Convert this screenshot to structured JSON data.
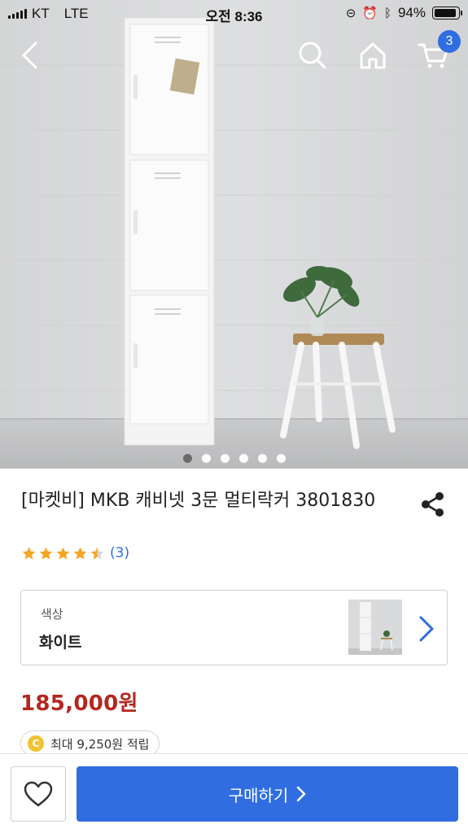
{
  "status_bar": {
    "carrier": "KT",
    "network": "LTE",
    "time": "오전 8:36",
    "battery": "94%",
    "battery_level": 0.94
  },
  "header": {
    "back_icon": "chevron-left-icon",
    "search_icon": "search-icon",
    "home_icon": "home-icon",
    "cart_icon": "cart-icon",
    "cart_count": "3"
  },
  "gallery": {
    "total_slides": 6,
    "active_index": 0
  },
  "product": {
    "title": "[마켓비] MKB 캐비넷 3문 멀티락커 3801830",
    "rating": 4.5,
    "review_count": "(3)"
  },
  "option": {
    "label": "색상",
    "value": "화이트"
  },
  "price": "185,000원",
  "points": {
    "coin_letter": "C",
    "text": "최대 9,250원 적립"
  },
  "bottom_bar": {
    "wishlist_icon": "heart-icon",
    "buy_label": "구매하기"
  },
  "colors": {
    "accent": "#2f6de1",
    "price": "#b4271f",
    "star": "#f5a623"
  }
}
